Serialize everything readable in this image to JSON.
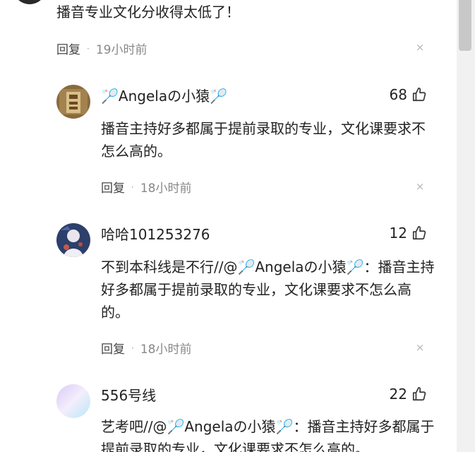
{
  "top_comment": {
    "text": "播音专业文化分收得太低了！",
    "reply_label": "回复",
    "dot": "·",
    "time": "19小时前"
  },
  "replies": [
    {
      "username": "🏸Angelaの小猿🏸",
      "likes": "68",
      "text": "播音主持好多都属于提前录取的专业，文化课要求不怎么高的。",
      "reply_label": "回复",
      "dot": "·",
      "time": "18小时前"
    },
    {
      "username": "哈哈101253276",
      "likes": "12",
      "text": "不到本科线是不行//@🏸Angelaの小猿🏸：播音主持好多都属于提前录取的专业，文化课要求不怎么高的。",
      "reply_label": "回复",
      "dot": "·",
      "time": "18小时前"
    },
    {
      "username": "556号线",
      "likes": "22",
      "text": "艺考吧//@🏸Angelaの小猿🏸：播音主持好多都属于提前录取的专业，文化课要求不怎么高的。"
    }
  ],
  "icons": {
    "close": "×",
    "like": "thumbs-up-icon"
  }
}
